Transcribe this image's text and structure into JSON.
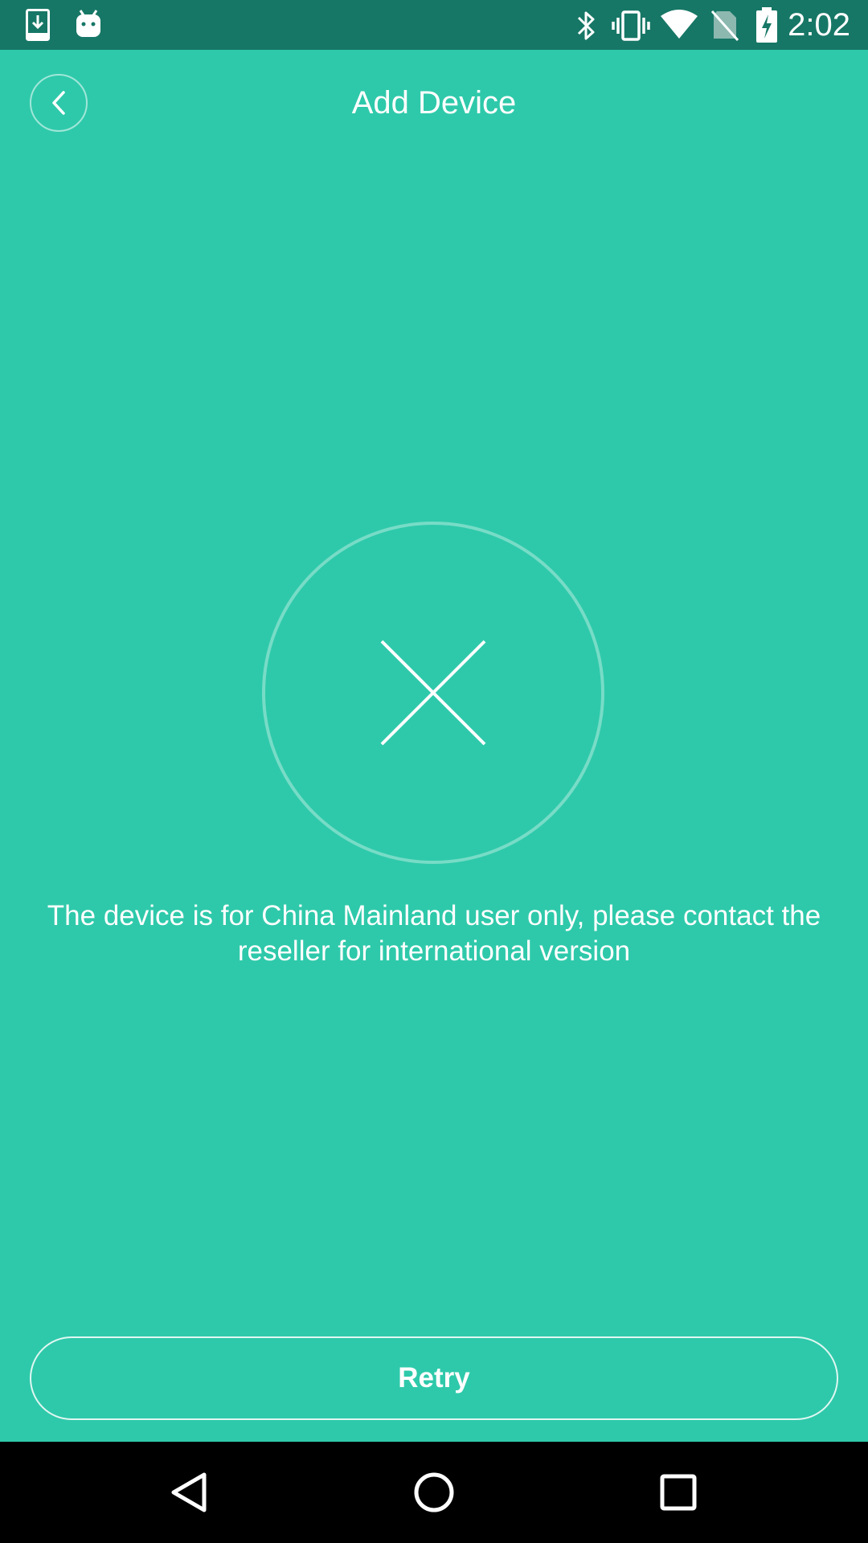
{
  "status_bar": {
    "time": "2:02",
    "icons": [
      "download-icon",
      "android-icon",
      "bluetooth-icon",
      "vibrate-icon",
      "wifi-icon",
      "no-sim-icon",
      "battery-charging-icon"
    ]
  },
  "header": {
    "title": "Add Device",
    "back_icon": "chevron-left-icon"
  },
  "error": {
    "icon": "close-icon",
    "message": "The device is for China Mainland user only, please contact the reseller for international version"
  },
  "actions": {
    "retry_label": "Retry"
  },
  "nav_bar": {
    "buttons": [
      "back-triangle-icon",
      "home-circle-icon",
      "recents-square-icon"
    ]
  },
  "colors": {
    "background": "#2ec9aa",
    "status_bar": "#177766",
    "nav_bar": "#000000",
    "text": "#ffffff"
  }
}
